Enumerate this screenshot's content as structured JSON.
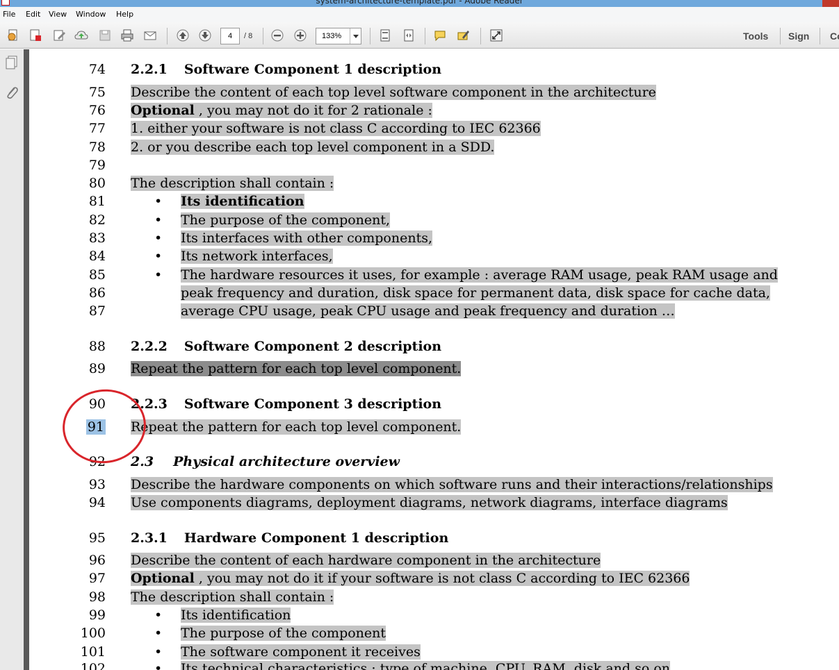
{
  "window": {
    "title": "system-architecture-template.pdf - Adobe Reader"
  },
  "menu": [
    "File",
    "Edit",
    "View",
    "Window",
    "Help"
  ],
  "toolbar": {
    "current_page": "4",
    "page_total": "/ 8",
    "zoom": "133%",
    "tools_label": "Tools",
    "sign_label": "Sign",
    "comment_label": "Co"
  },
  "document": {
    "lines": [
      {
        "n": "74",
        "kind": "heading",
        "num": "2.2.1",
        "text": "Software Component 1 description"
      },
      {
        "n": "75",
        "kind": "text",
        "text": "Describe the content of each top level software component in the architecture"
      },
      {
        "n": "76",
        "kind": "bold-lead",
        "bold": "Optional",
        "text": " , you may not do it for 2 rationale :"
      },
      {
        "n": "77",
        "kind": "text",
        "text": "1. either your software is not class C according to IEC 62366"
      },
      {
        "n": "78",
        "kind": "text",
        "text": "2. or you describe each top level component in a SDD."
      },
      {
        "n": "79",
        "kind": "blank",
        "text": ""
      },
      {
        "n": "80",
        "kind": "text",
        "text": "The description shall contain :"
      },
      {
        "n": "81",
        "kind": "bullet-bold",
        "text": "Its identification"
      },
      {
        "n": "82",
        "kind": "bullet",
        "text": "The purpose of the component,"
      },
      {
        "n": "83",
        "kind": "bullet",
        "text": "Its interfaces with other components,"
      },
      {
        "n": "84",
        "kind": "bullet",
        "text": "Its network interfaces,"
      },
      {
        "n": "85",
        "kind": "bullet",
        "text": "The hardware resources it uses, for example : average RAM usage, peak RAM usage and"
      },
      {
        "n": "86",
        "kind": "cont",
        "text": "peak frequency and duration, disk space for permanent data, disk space for cache data,"
      },
      {
        "n": "87",
        "kind": "cont",
        "text": "average CPU usage, peak CPU usage and peak frequency and duration …"
      },
      {
        "n": "88",
        "kind": "heading",
        "num": "2.2.2",
        "text": "Software Component 2 description"
      },
      {
        "n": "89",
        "kind": "text-dark",
        "text": "Repeat the pattern for each top level component."
      },
      {
        "n": "90",
        "kind": "heading",
        "num": "2.2.3",
        "text": "Software Component 3 description"
      },
      {
        "n": "91",
        "kind": "text",
        "text": "Repeat the pattern for each top level component."
      },
      {
        "n": "92",
        "kind": "heading-italic",
        "num": "2.3",
        "text": "Physical architecture overview"
      },
      {
        "n": "93",
        "kind": "text",
        "text": "Describe the hardware components on which software runs and their interactions/relationships"
      },
      {
        "n": "94",
        "kind": "text",
        "text": "Use components diagrams, deployment diagrams, network diagrams, interface diagrams"
      },
      {
        "n": "95",
        "kind": "heading",
        "num": "2.3.1",
        "text": "Hardware Component 1 description"
      },
      {
        "n": "96",
        "kind": "text",
        "text": "Describe the content of each hardware component in the architecture"
      },
      {
        "n": "97",
        "kind": "bold-lead",
        "bold": "Optional",
        "text": " , you may not do it if your software is not class C according to IEC 62366"
      },
      {
        "n": "98",
        "kind": "text",
        "text": "The description shall contain :"
      },
      {
        "n": "99",
        "kind": "bullet",
        "text": "Its identification"
      },
      {
        "n": "100",
        "kind": "bullet",
        "text": "The purpose of the component"
      },
      {
        "n": "101",
        "kind": "bullet",
        "text": "The software component it receives"
      },
      {
        "n": "102",
        "kind": "bullet",
        "text": "Its technical characteristics : type of machine, CPU, RAM, disk and so on"
      }
    ]
  }
}
